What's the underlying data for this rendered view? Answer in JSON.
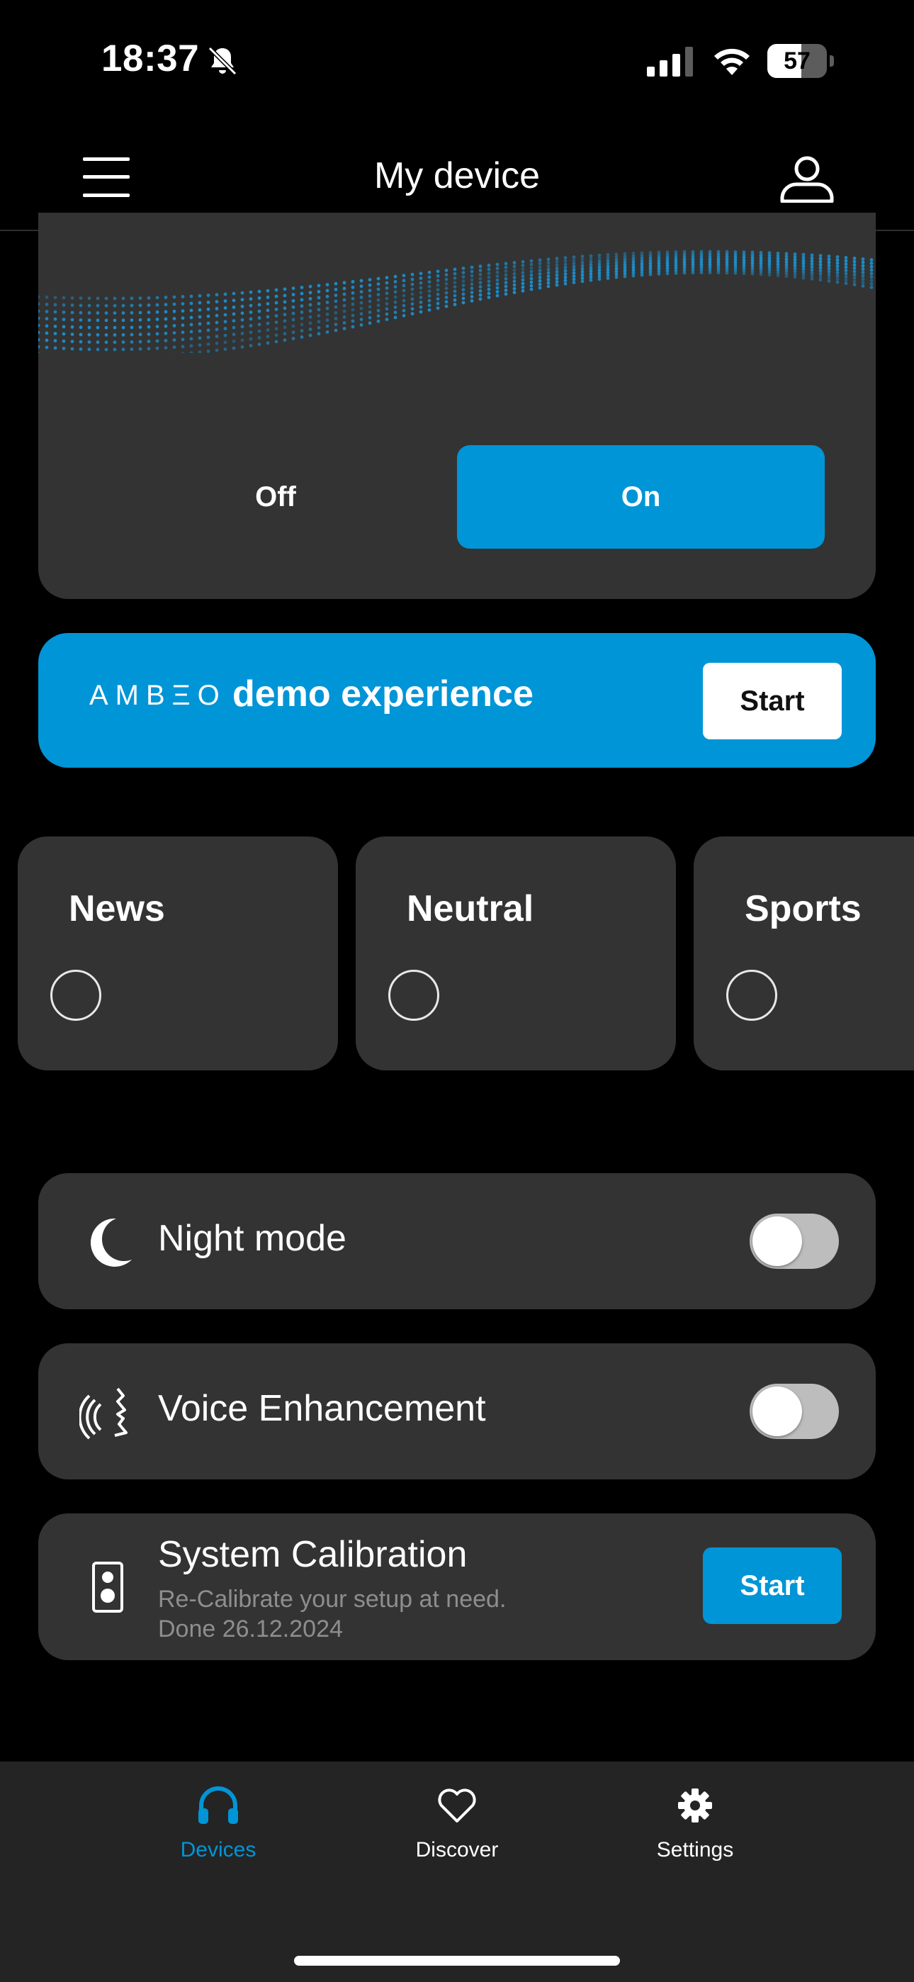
{
  "status_bar": {
    "time": "18:37",
    "battery": "57",
    "battery_level": 0.57
  },
  "header": {
    "title": "My device"
  },
  "hero": {
    "off_label": "Off",
    "on_label": "On",
    "selected": "On"
  },
  "demo": {
    "logo_text": "AMBΞO",
    "text": "demo experience",
    "start_label": "Start"
  },
  "presets": [
    {
      "label": "News",
      "selected": false
    },
    {
      "label": "Neutral",
      "selected": false
    },
    {
      "label": "Sports",
      "selected": false
    }
  ],
  "night_mode": {
    "label": "Night mode",
    "enabled": false
  },
  "voice_enhancement": {
    "label": "Voice Enhancement",
    "enabled": false
  },
  "calibration": {
    "title": "System Calibration",
    "subtitle_line1": "Re-Calibrate your setup at need.",
    "subtitle_line2": "Done 26.12.2024",
    "start_label": "Start"
  },
  "nav": [
    {
      "label": "Devices",
      "icon": "headphones-icon",
      "active": true
    },
    {
      "label": "Discover",
      "icon": "heart-icon",
      "active": false
    },
    {
      "label": "Settings",
      "icon": "gear-icon",
      "active": false
    }
  ],
  "colors": {
    "accent": "#0095d6",
    "card": "#333333",
    "background": "#000000",
    "nav_bg": "#242424"
  }
}
